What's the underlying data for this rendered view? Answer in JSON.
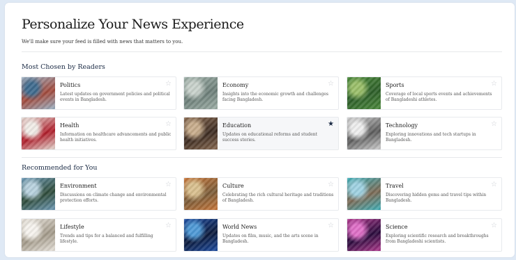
{
  "header": {
    "title": "Personalize Your News Experience",
    "subtitle": "We'll make sure your feed is filled with news that matters to you."
  },
  "sections": [
    {
      "title": "Most Chosen by Readers",
      "cards": [
        {
          "name": "Politics",
          "desc": "Latest updates on government policies and political events in Bangladesh.",
          "starred": false,
          "thumb_colors": [
            "#9bb3c6",
            "#a34a3c",
            "#3f6b8e"
          ]
        },
        {
          "name": "Economy",
          "desc": "Insights into the economic growth and challenges facing Bangladesh.",
          "starred": false,
          "thumb_colors": [
            "#9fb0a8",
            "#6d7f79",
            "#c9d2cc"
          ]
        },
        {
          "name": "Sports",
          "desc": "Coverage of local sports events and achievements of Bangladeshi athletes.",
          "starred": false,
          "thumb_colors": [
            "#4c8a3c",
            "#2e5f2a",
            "#9bbf6a"
          ]
        },
        {
          "name": "Health",
          "desc": "Information on healthcare advancements and public health initiatives.",
          "starred": false,
          "thumb_colors": [
            "#e5dcd4",
            "#b01d2a",
            "#f1ece7"
          ]
        },
        {
          "name": "Education",
          "desc": "Updates on educational reforms and student success stories.",
          "starred": true,
          "thumb_colors": [
            "#8a6b52",
            "#3d2c22",
            "#c8ad8c"
          ]
        },
        {
          "name": "Technology",
          "desc": "Exploring innovations and tech startups in Bangladesh.",
          "starred": false,
          "thumb_colors": [
            "#cfcfcf",
            "#5c5c5c",
            "#eeeeee"
          ]
        }
      ]
    },
    {
      "title": "Recommended for You",
      "cards": [
        {
          "name": "Environment",
          "desc": "Discussions on climate change and environmental protection efforts.",
          "starred": false,
          "thumb_colors": [
            "#6f9bb7",
            "#2f4c3a",
            "#b8d1de"
          ]
        },
        {
          "name": "Culture",
          "desc": "Celebrating the rich cultural heritage and traditions of Bangladesh.",
          "starred": false,
          "thumb_colors": [
            "#c9773a",
            "#7b5d3a",
            "#d9c08f"
          ]
        },
        {
          "name": "Travel",
          "desc": "Discovering hidden gems and travel tips within Bangladesh.",
          "starred": false,
          "thumb_colors": [
            "#3fb0b9",
            "#7d6a55",
            "#9fd2e2"
          ]
        },
        {
          "name": "Lifestyle",
          "desc": "Trends and tips for a balanced and fulfilling lifestyle.",
          "starred": false,
          "thumb_colors": [
            "#e8e3db",
            "#a39a8a",
            "#f6f3ee"
          ]
        },
        {
          "name": "World News",
          "desc": "Updates on film, music, and the arts scene in Bangladesh.",
          "starred": false,
          "thumb_colors": [
            "#1f4ea3",
            "#0c1a3b",
            "#4f9ad6"
          ]
        },
        {
          "name": "Science",
          "desc": "Exploring scientific research and breakthroughs from Bangladeshi scientists.",
          "starred": false,
          "thumb_colors": [
            "#b23a8f",
            "#2a0c3d",
            "#e070c8"
          ]
        }
      ]
    }
  ]
}
